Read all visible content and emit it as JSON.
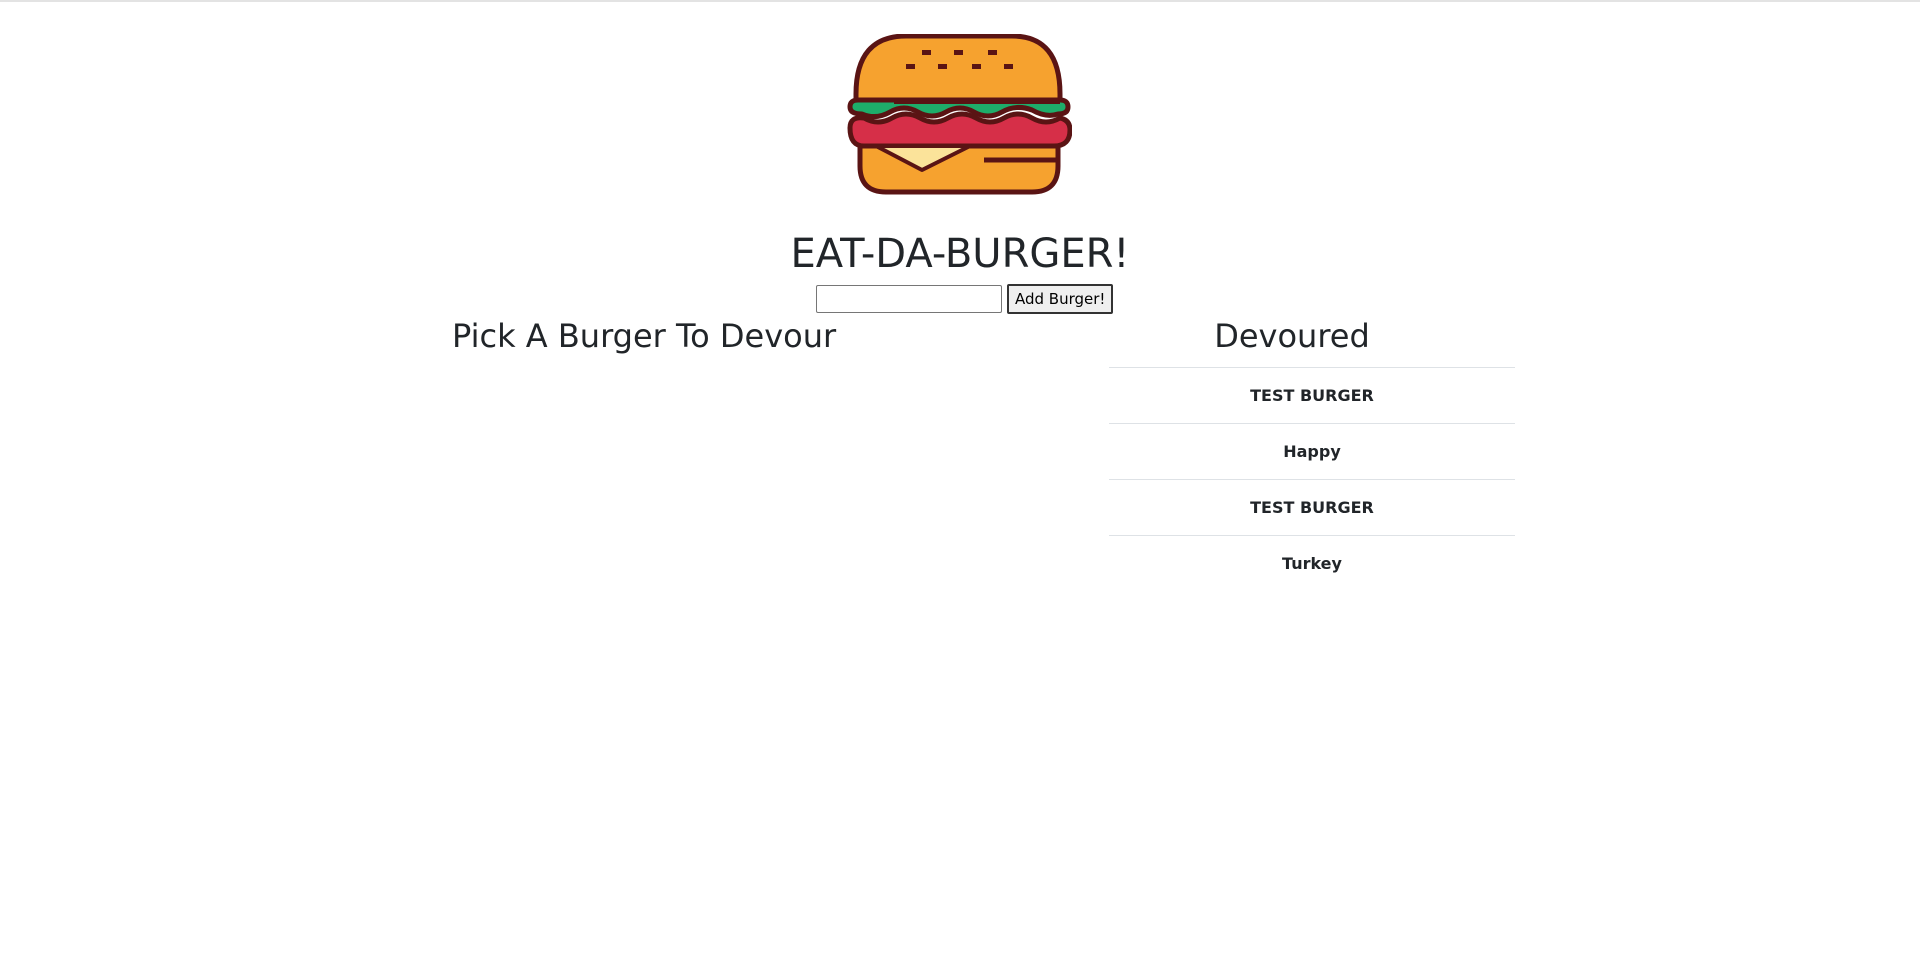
{
  "header": {
    "logo_icon": "hamburger-logo-icon",
    "title": "EAT-DA-BURGER!"
  },
  "form": {
    "input_value": "",
    "input_placeholder": "",
    "add_button_label": "Add Burger!"
  },
  "columns": {
    "left_heading": "Pick A Burger To Devour",
    "right_heading": "Devoured"
  },
  "devoured": [
    "TEST BURGER",
    "Happy",
    "TEST BURGER",
    "Turkey"
  ],
  "colors": {
    "bun": "#F6A22F",
    "outline": "#5A1414",
    "lettuce": "#1EAD6A",
    "patty": "#D62F48",
    "cheese": "#FBE39A"
  }
}
